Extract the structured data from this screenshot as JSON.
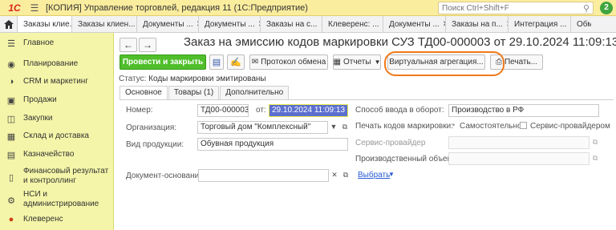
{
  "titlebar": {
    "title": "[КОПИЯ] Управление торговлей, редакция 11  (1С:Предприятие)",
    "search_placeholder": "Поиск Ctrl+Shift+F",
    "notification_count": "2"
  },
  "tabs": [
    "Заказы клие...",
    "Заказы клиен...",
    "Документы ...",
    "Документы ...",
    "Заказы на с...",
    "Клеверенс: ...",
    "Документы ...",
    "Заказы на п...",
    "Интеграция ...",
    "Обм"
  ],
  "sidebar": {
    "items": [
      {
        "label": "Главное",
        "icon": "menu-icon"
      },
      {
        "label": "Планирование",
        "icon": "planning-icon"
      },
      {
        "label": "CRM и маркетинг",
        "icon": "crm-icon"
      },
      {
        "label": "Продажи",
        "icon": "sales-icon"
      },
      {
        "label": "Закупки",
        "icon": "purchases-icon"
      },
      {
        "label": "Склад и доставка",
        "icon": "warehouse-icon"
      },
      {
        "label": "Казначейство",
        "icon": "treasury-icon"
      },
      {
        "label": "Финансовый результат и контроллинг",
        "icon": "finance-icon"
      },
      {
        "label": "НСИ и администрирование",
        "icon": "settings-icon"
      },
      {
        "label": "Клеверенс",
        "icon": "cleverence-icon"
      }
    ]
  },
  "document": {
    "title": "Заказ на эмиссию кодов маркировки СУЗ ТД00-000003 от 29.10.2024 11:09:13",
    "toolbar": {
      "post_close": "Провести и закрыть",
      "exchange_protocol": "Протокол обмена",
      "reports": "Отчеты",
      "virtual_aggregation": "Виртуальная агрегация...",
      "print": "Печать..."
    },
    "status_label": "Статус:",
    "status_value": "Коды маркировки эмитированы",
    "tabs": [
      "Основное",
      "Товары (1)",
      "Дополнительно"
    ],
    "fields": {
      "number_label": "Номер:",
      "number_value": "ТД00-000003",
      "date_label": "от:",
      "date_value": "29.10.2024 11:09:13",
      "org_label": "Организация:",
      "org_value": "Торговый дом \"Комплексный\"",
      "product_type_label": "Вид продукции:",
      "product_type_value": "Обувная продукция",
      "base_doc_label": "Документ-основание:",
      "base_doc_value": "",
      "select_link": "Выбрать",
      "input_method_label": "Способ ввода в оборот:",
      "input_method_value": "Производство в РФ",
      "print_codes_label": "Печать кодов маркировки:",
      "print_self": "Самостоятельно",
      "print_provider": "Сервис-провайдером",
      "service_provider_label": "Сервис-провайдер",
      "production_object_label": "Производственный объект:"
    }
  }
}
